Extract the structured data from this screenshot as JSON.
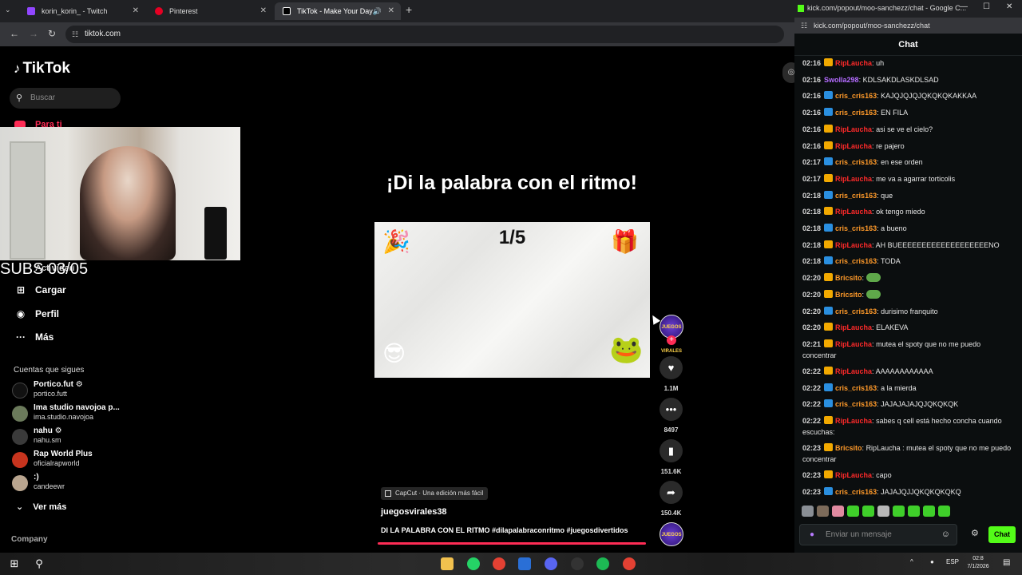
{
  "browser": {
    "tabs": [
      {
        "label": "korin_korin_ - Twitch",
        "color": "#9146ff"
      },
      {
        "label": "Pinterest",
        "color": "#e60023"
      },
      {
        "label": "TikTok - Make Your Day",
        "color": "#ffffff"
      }
    ],
    "url": "tiktok.com"
  },
  "tiktok": {
    "logo": "TikTok",
    "search_placeholder": "Buscar",
    "foryou": "Para ti",
    "overlay_subs": "SUBS 03/05",
    "overlay_actividad": "Actividad",
    "nav": [
      {
        "label": "Cargar",
        "icon": "upload-icon"
      },
      {
        "label": "Perfil",
        "icon": "profile-icon"
      },
      {
        "label": "Más",
        "icon": "more-icon"
      }
    ],
    "following_title": "Cuentas que sigues",
    "following": [
      {
        "name": "Portico.fut ⚙",
        "handle": "portico.futt",
        "color": "#111111"
      },
      {
        "name": "Ima studio navojoa p...",
        "handle": "ima.studio.navojoa",
        "color": "#6b7a5b"
      },
      {
        "name": "nahu ⚙",
        "handle": "nahu.sm",
        "color": "#3a3a3a"
      },
      {
        "name": "Rap World Plus",
        "handle": "oficialrapworld",
        "color": "#c7341e"
      },
      {
        "name": ":)",
        "handle": "candeewr",
        "color": "#b9a58f"
      }
    ],
    "see_more": "Ver más",
    "company": "Company",
    "video": {
      "heading": "¡Di la palabra con el ritmo!",
      "counter": "1/5",
      "capcut": "CapCut · Una edición más fácil",
      "author": "juegosvirales38",
      "description": "DI LA PALABRA CON EL RITMO #dilapalabraconritmo #juegosdivertidos",
      "likes": "1.1M",
      "comments": "8497",
      "saves": "151.6K",
      "shares": "150.4K",
      "avatar_text": "JUEGOS VIRALES"
    }
  },
  "kick": {
    "window_title": "kick.com/popout/moo-sanchezz/chat - Google C...",
    "url": "kick.com/popout/moo-sanchezz/chat",
    "header": "Chat",
    "messages": [
      {
        "t": "02:16",
        "u": "RipLaucha",
        "c": "#ff2a2a",
        "b": "#f2a900",
        "m": "uh"
      },
      {
        "t": "02:16",
        "u": "Swolla298",
        "c": "#b46cff",
        "b": "",
        "m": "KDLSAKDLASKDLSAD"
      },
      {
        "t": "02:16",
        "u": "cris_cris163",
        "c": "#ff9a2a",
        "b": "#2a8fe0",
        "m": "KAJQJQJQJQKQKQKAKKAA"
      },
      {
        "t": "02:16",
        "u": "cris_cris163",
        "c": "#ff9a2a",
        "b": "#2a8fe0",
        "m": "EN FILA"
      },
      {
        "t": "02:16",
        "u": "RipLaucha",
        "c": "#ff2a2a",
        "b": "#f2a900",
        "m": "asi se ve el cielo?"
      },
      {
        "t": "02:16",
        "u": "RipLaucha",
        "c": "#ff2a2a",
        "b": "#f2a900",
        "m": "re pajero"
      },
      {
        "t": "02:17",
        "u": "cris_cris163",
        "c": "#ff9a2a",
        "b": "#2a8fe0",
        "m": "en ese orden"
      },
      {
        "t": "02:17",
        "u": "RipLaucha",
        "c": "#ff2a2a",
        "b": "#f2a900",
        "m": "me va a agarrar torticolis"
      },
      {
        "t": "02:18",
        "u": "cris_cris163",
        "c": "#ff9a2a",
        "b": "#2a8fe0",
        "m": "que"
      },
      {
        "t": "02:18",
        "u": "RipLaucha",
        "c": "#ff2a2a",
        "b": "#f2a900",
        "m": "ok tengo miedo"
      },
      {
        "t": "02:18",
        "u": "cris_cris163",
        "c": "#ff9a2a",
        "b": "#2a8fe0",
        "m": "a bueno"
      },
      {
        "t": "02:18",
        "u": "RipLaucha",
        "c": "#ff2a2a",
        "b": "#f2a900",
        "m": "AH BUEEEEEEEEEEEEEEEEEEENO"
      },
      {
        "t": "02:18",
        "u": "cris_cris163",
        "c": "#ff9a2a",
        "b": "#2a8fe0",
        "m": "TODA"
      },
      {
        "t": "02:20",
        "u": "Bricsito",
        "c": "#ff9a2a",
        "b": "#f2a900",
        "m": ""
      },
      {
        "t": "02:20",
        "u": "Bricsito",
        "c": "#ff9a2a",
        "b": "#f2a900",
        "m": ""
      },
      {
        "t": "02:20",
        "u": "cris_cris163",
        "c": "#ff9a2a",
        "b": "#2a8fe0",
        "m": "durisimo franquito"
      },
      {
        "t": "02:20",
        "u": "RipLaucha",
        "c": "#ff2a2a",
        "b": "#f2a900",
        "m": "ELAKEVA"
      },
      {
        "t": "02:21",
        "u": "RipLaucha",
        "c": "#ff2a2a",
        "b": "#f2a900",
        "m": "mutea el spoty que no me puedo concentrar"
      },
      {
        "t": "02:22",
        "u": "RipLaucha",
        "c": "#ff2a2a",
        "b": "#f2a900",
        "m": "AAAAAAAAAAAA"
      },
      {
        "t": "02:22",
        "u": "cris_cris163",
        "c": "#ff9a2a",
        "b": "#2a8fe0",
        "m": "a la mierda"
      },
      {
        "t": "02:22",
        "u": "cris_cris163",
        "c": "#ff9a2a",
        "b": "#2a8fe0",
        "m": "JAJAJAJAJQJQKQKQK"
      },
      {
        "t": "02:22",
        "u": "RipLaucha",
        "c": "#ff2a2a",
        "b": "#f2a900",
        "m": "sabes q cell está hecho concha cuando escuchas:"
      },
      {
        "t": "02:23",
        "u": "Bricsito",
        "c": "#ff9a2a",
        "b": "#f2a900",
        "m": "RipLaucha : mutea el spoty que no me puedo concentrar"
      },
      {
        "t": "02:23",
        "u": "RipLaucha",
        "c": "#ff2a2a",
        "b": "#f2a900",
        "m": "capo"
      },
      {
        "t": "02:23",
        "u": "cris_cris163",
        "c": "#ff9a2a",
        "b": "#2a8fe0",
        "m": "JAJAJQJJQKQKQKQKQ"
      }
    ],
    "input_placeholder": "Enviar un mensaje",
    "send_label": "Chat"
  },
  "taskbar": {
    "lang": "ESP",
    "time": "02:8",
    "date": "7/1/2026"
  }
}
